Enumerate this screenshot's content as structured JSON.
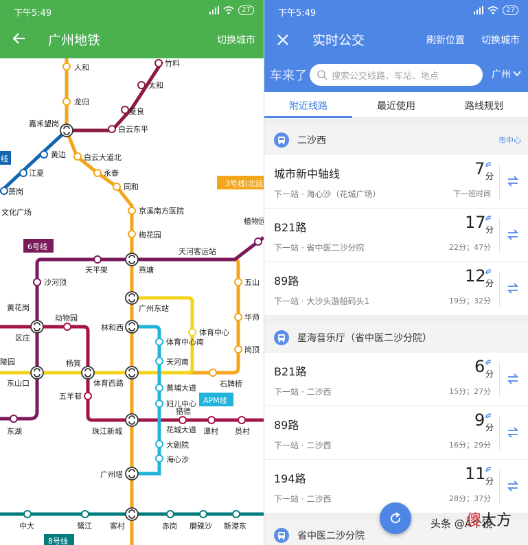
{
  "status": {
    "time": "下午5:49",
    "battery": "27"
  },
  "left": {
    "title": "广州地铁",
    "switch_city": "切换城市",
    "lines": {
      "line3": "3号线(北延",
      "line6": "6号线",
      "line8": "8号线",
      "apm": "APM线",
      "line2_cut": "线"
    },
    "stations": {
      "renhe": "人和",
      "longgui": "龙归",
      "jiahewanggang": "嘉禾望岗",
      "zhuliao": "竹料",
      "taihe": "太和",
      "xialiang": "夏良",
      "baiyundongping": "白云东平",
      "huangbian": "黄边",
      "jiangxia": "江夏",
      "xiaogang": "萧岗",
      "wenhuaguangchang": "文化广场",
      "baiyundadaobei": "白云大道北",
      "yongtai": "永泰",
      "tonghe": "同和",
      "jingxinanfangyiyuan": "京溪南方医院",
      "meihuayuan": "梅花园",
      "zhiwuyuan": "植物园",
      "tianhekeyunzhan": "天河客运站",
      "tianpingjia": "天平架",
      "yantang": "燕塘",
      "wushan": "五山",
      "shahedding": "沙河顶",
      "guangzhoudongzhan": "广州东站",
      "huanghuagang": "黄花岗",
      "dongwuyuan": "动物园",
      "linhexi": "林和西",
      "tiyuzhongxin": "体育中心",
      "huashi": "华师",
      "quzhuang": "区庄",
      "tiyuzhongxinnan": "体育中心南",
      "tianhenan": "天河南",
      "gangding": "岗顶",
      "lingyuan": "陵园",
      "yangji": "杨箕",
      "dongshankou": "东山口",
      "tiyuxilu": "体育西路",
      "shipaiqiao": "石牌桥",
      "wuyangcun": "五羊邨",
      "huangpudadao": "黄埔大道",
      "furuzhongxin": "妇儿中心",
      "liede": "猎德",
      "donghu": "东湖",
      "zhujiangxincheng": "珠江新城",
      "huachengdadao": "花城大道",
      "tancun": "潭村",
      "yuancun": "员村",
      "dajuyuan": "大剧院",
      "haixinsha": "海心沙",
      "guangzhouta": "广州塔",
      "zhongda": "中大",
      "lujiang": "鹭江",
      "kecun": "客村",
      "chigang": "赤岗",
      "modiesha": "磨碟沙",
      "xingangdong": "新港东"
    }
  },
  "right": {
    "title": "实时公交",
    "refresh": "刷新位置",
    "switch_city": "切换城市",
    "brand": "车来了",
    "search_placeholder": "搜索公交线路、车站、地点",
    "city": "广州",
    "tabs": [
      "附近线路",
      "最近使用",
      "路线规划"
    ],
    "groups": [
      {
        "station": "二沙西",
        "tag": "市中心",
        "routes": [
          {
            "name": "城市新中轴线",
            "next": "下一站 · 海心沙（花城广场）",
            "eta": "7",
            "unit": "分",
            "sub": "下一班时间"
          },
          {
            "name": "B21路",
            "next": "下一站 · 省中医二沙分院",
            "eta": "17",
            "unit": "分",
            "sub": "22分；47分"
          },
          {
            "name": "89路",
            "next": "下一站 · 大沙头游船码头1",
            "eta": "12",
            "unit": "分",
            "sub": "19分；32分"
          }
        ]
      },
      {
        "station": "星海音乐厅（省中医二沙分院）",
        "tag": "",
        "routes": [
          {
            "name": "B21路",
            "next": "下一站 · 二沙西",
            "eta": "6",
            "unit": "分",
            "sub": "15分；27分"
          },
          {
            "name": "89路",
            "next": "下一站 · 二沙西",
            "eta": "9",
            "unit": "分",
            "sub": "16分；29分"
          },
          {
            "name": "194路",
            "next": "下一站 · 二沙西",
            "eta": "11",
            "unit": "分",
            "sub": "28分；37分"
          }
        ]
      },
      {
        "station": "省中医二沙分院",
        "tag": "",
        "routes": []
      }
    ],
    "watermark": "头条 @A个镜",
    "watermark_logo_a": "傻",
    "watermark_logo_b": "大方"
  },
  "colors": {
    "green_header": "#4bb04e",
    "blue_header": "#4e86e5",
    "line_orange": "#f3a61b",
    "line_maroon": "#8b1b42",
    "line_line6": "#7a1a5b",
    "line_yellow": "#f0d41e",
    "line_blue": "#1365b0",
    "line_apm": "#21b3da",
    "line_teal": "#037c7d"
  }
}
